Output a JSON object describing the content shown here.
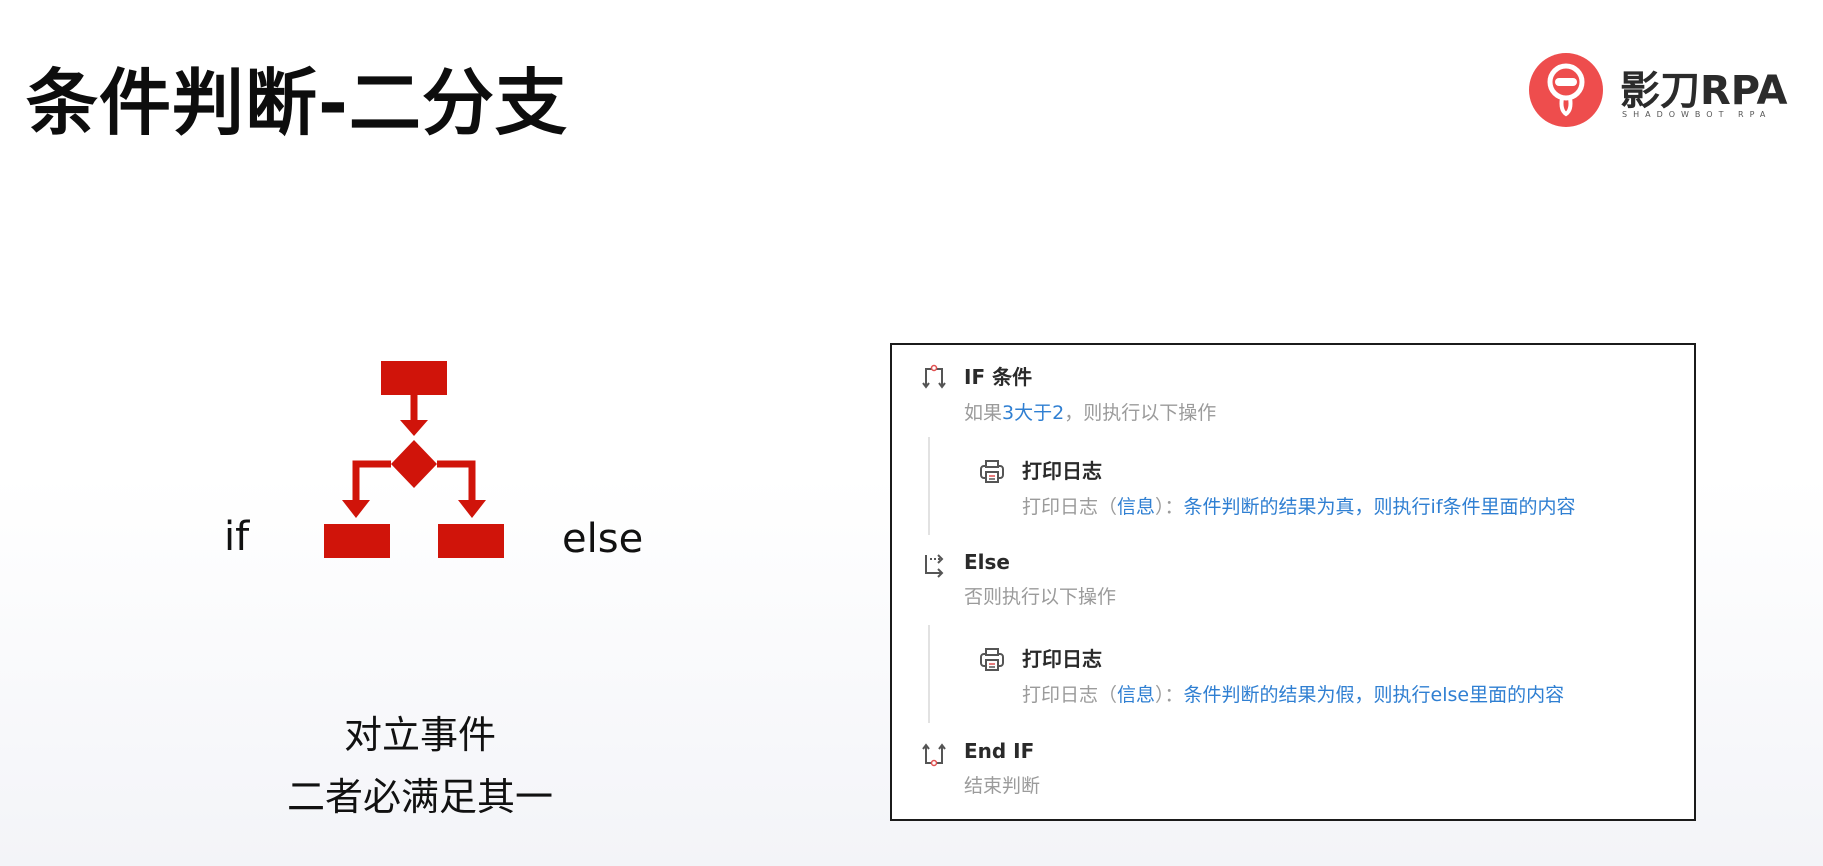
{
  "slide": {
    "title": "条件判断-二分支"
  },
  "logo": {
    "brand": "影刀RPA",
    "subtitle": "SHADOWBOT RPA",
    "brand_color": "#ee4d4d"
  },
  "diagram": {
    "if_label": "if",
    "else_label": "else",
    "caption_line1": "对立事件",
    "caption_line2": "二者必满足其一",
    "icon": "flowchart-branch-icon",
    "icon_color": "#d0140a"
  },
  "panel": {
    "accent_color": "#2f7fd2",
    "if_block": {
      "icon": "if-condition-icon",
      "title": "IF 条件",
      "desc_prefix": "如果",
      "desc_condition": "3大于2",
      "desc_suffix": "，则执行以下操作"
    },
    "log_true": {
      "icon": "print-log-icon",
      "title": "打印日志",
      "desc_prefix": "打印日志（",
      "desc_level": "信息",
      "desc_mid": "）：",
      "desc_message": "条件判断的结果为真，则执行if条件里面的内容"
    },
    "else_block": {
      "icon": "else-branch-icon",
      "title": "Else",
      "desc": "否则执行以下操作"
    },
    "log_false": {
      "icon": "print-log-icon",
      "title": "打印日志",
      "desc_prefix": "打印日志（",
      "desc_level": "信息",
      "desc_mid": "）：",
      "desc_message": "条件判断的结果为假，则执行else里面的内容"
    },
    "end_block": {
      "icon": "end-if-icon",
      "title": "End IF",
      "desc": "结束判断"
    }
  }
}
